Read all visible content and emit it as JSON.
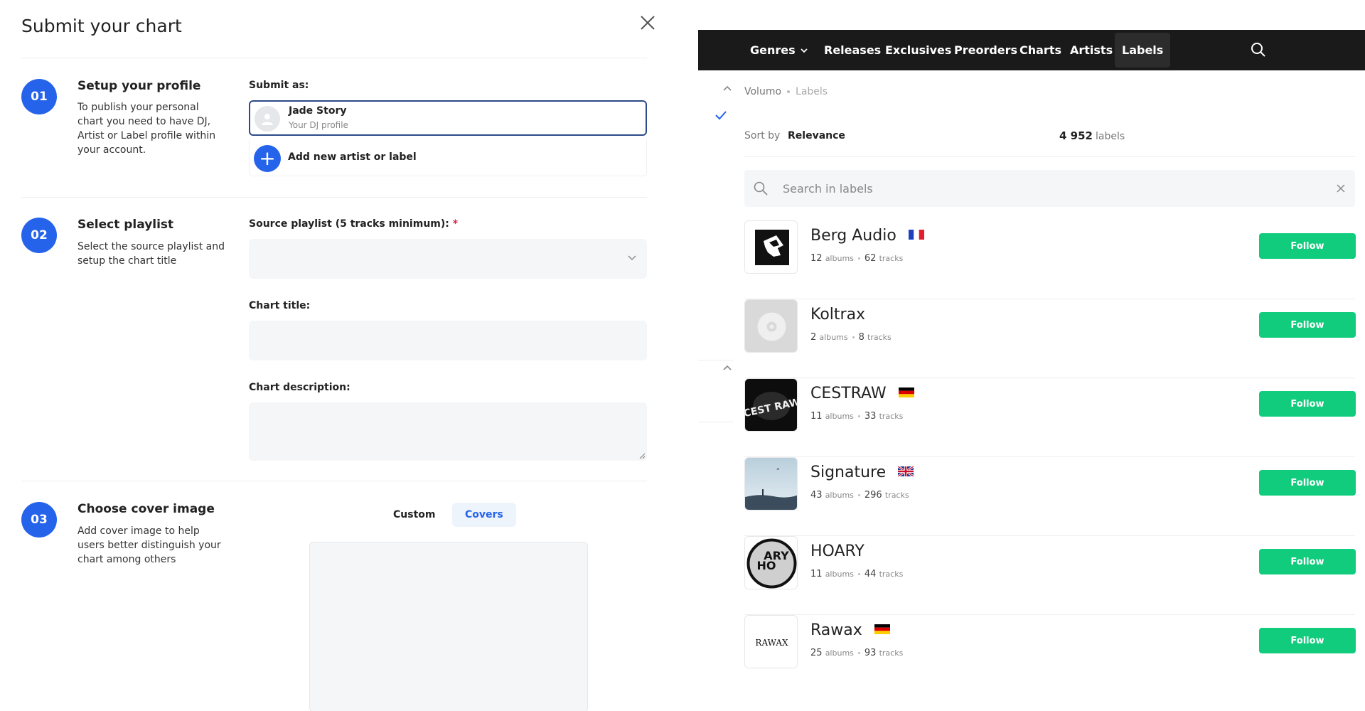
{
  "modal": {
    "title": "Submit your chart",
    "steps": [
      {
        "number": "01",
        "title": "Setup your profile",
        "description": "To publish your personal chart you need to have DJ, Artist or Label profile within your account."
      },
      {
        "number": "02",
        "title": "Select playlist",
        "description": "Select the source playlist and setup the chart title"
      },
      {
        "number": "03",
        "title": "Choose cover image",
        "description": "Add cover image to help users better distinguish your chart among others"
      }
    ],
    "submit_as_label": "Submit as:",
    "profile": {
      "name": "Jade Story",
      "subtitle": "Your DJ profile"
    },
    "add_new_label": "Add new artist or label",
    "add_new_symbol": "+",
    "source_playlist_label": "Source playlist (5 tracks minimum):",
    "required_mark": "*",
    "chart_title_label": "Chart title:",
    "chart_description_label": "Chart description:",
    "cover_tabs": {
      "custom": "Custom",
      "covers": "Covers"
    }
  },
  "labels_page": {
    "nav": [
      "Genres",
      "Releases",
      "Exclusives",
      "Preorders",
      "Charts",
      "Artists",
      "Labels"
    ],
    "active_nav": "Labels",
    "breadcrumb": [
      "Volumo",
      "Labels"
    ],
    "sort_label": "Sort by",
    "sort_value": "Relevance",
    "count_value": "4 952",
    "count_unit": "labels",
    "search_placeholder": "Search in labels",
    "albums_unit": "albums",
    "tracks_unit": "tracks",
    "follow_label": "Follow",
    "labels": [
      {
        "name": "Berg Audio",
        "albums": "12",
        "tracks": "62",
        "flag": "france-flag-icon"
      },
      {
        "name": "Koltrax",
        "albums": "2",
        "tracks": "8",
        "flag": ""
      },
      {
        "name": "CESTRAW",
        "albums": "11",
        "tracks": "33",
        "flag": "germany-flag-icon"
      },
      {
        "name": "Signature",
        "albums": "43",
        "tracks": "296",
        "flag": "uk-flag-icon"
      },
      {
        "name": "HOARY",
        "albums": "11",
        "tracks": "44",
        "flag": ""
      },
      {
        "name": "Rawax",
        "albums": "25",
        "tracks": "93",
        "flag": "germany-flag-icon"
      }
    ],
    "logo_texts": {
      "hoary_top": "ARY",
      "hoary_bottom": "HO",
      "rawax": "RAWAX",
      "cestraw": "CEST RAW"
    }
  },
  "colors": {
    "accent_blue": "#2563eb",
    "follow_green": "#12cc7e",
    "nav_dark": "#1a1a1a"
  }
}
